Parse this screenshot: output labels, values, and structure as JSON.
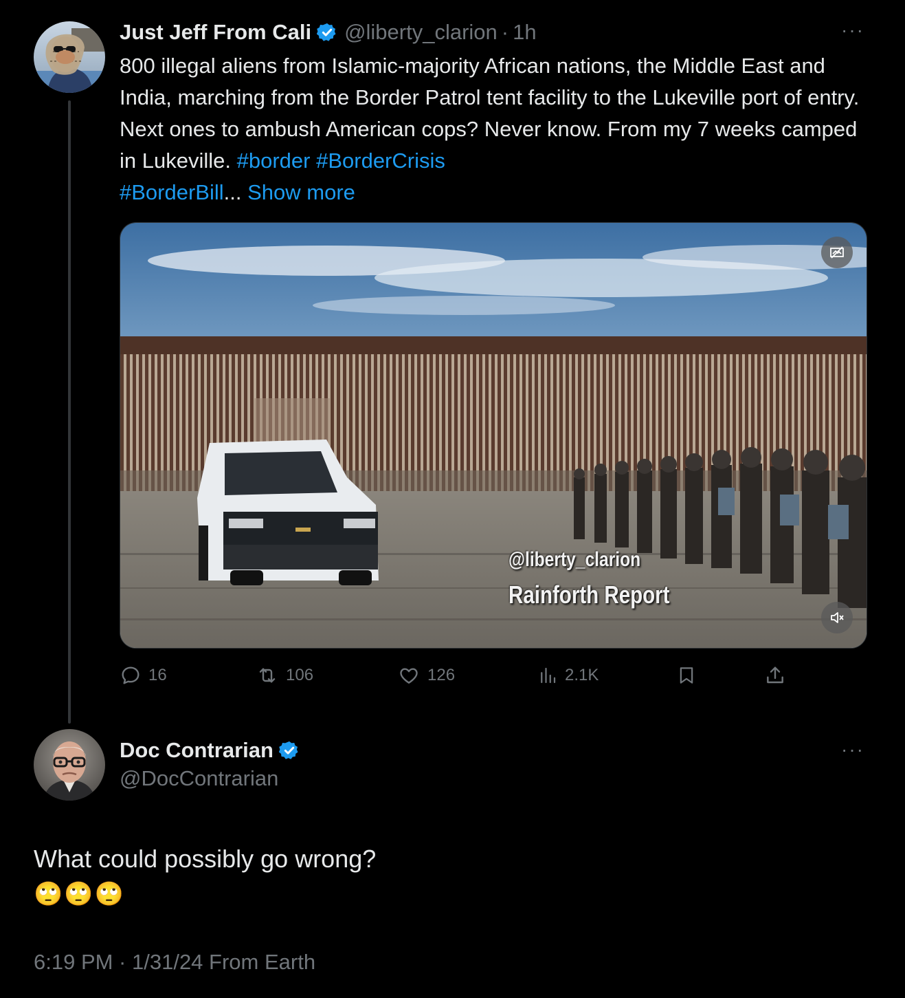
{
  "tweet1": {
    "display_name": "Just Jeff From Cali",
    "handle": "@liberty_clarion",
    "separator": "·",
    "time": "1h",
    "more_label": "···",
    "text_main": "800 illegal aliens from Islamic-majority African nations, the Middle East and India, marching from the Border Patrol tent facility to the Lukeville port of entry. Next ones to ambush American cops? Never know. From my 7 weeks camped in Lukeville.",
    "hashtags": [
      "#border",
      "#BorderCrisis",
      "#BorderBill"
    ],
    "ellipsis": "...",
    "show_more": "Show more",
    "media": {
      "watermark_line1": "@liberty_clarion",
      "watermark_line2": "Rainforth Report",
      "sensitive_icon": "eye-slash-icon",
      "mute_icon": "speaker-muted-icon"
    },
    "actions": {
      "replies": "16",
      "reposts": "106",
      "likes": "126",
      "views": "2.1K"
    }
  },
  "tweet2": {
    "display_name": "Doc Contrarian",
    "handle": "@DocContrarian",
    "more_label": "···",
    "text": "What could possibly go wrong?",
    "emoji": "🙄🙄🙄",
    "timestamp": "6:19 PM · 1/31/24 From Earth"
  },
  "colors": {
    "background": "#000000",
    "text": "#e7e9ea",
    "muted": "#71767b",
    "accent": "#1d9bf0"
  }
}
